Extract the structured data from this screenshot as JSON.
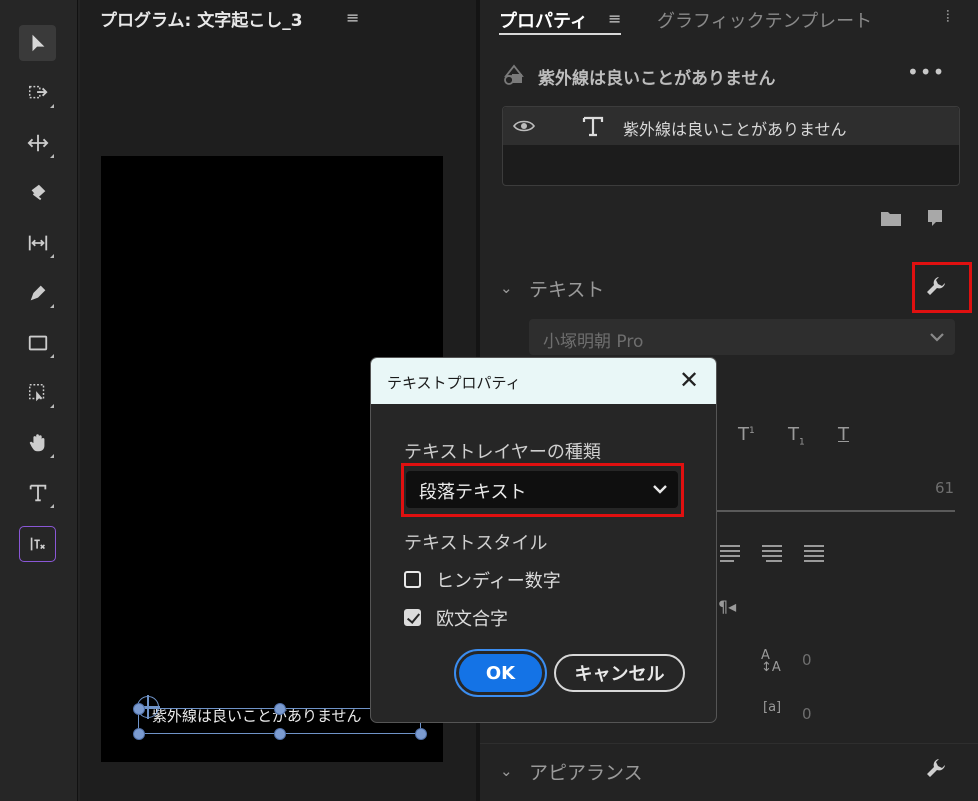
{
  "program": {
    "title": "プログラム: 文字起こし_3",
    "caption": "紫外線は良いことがありません"
  },
  "properties": {
    "tabs": [
      {
        "label": "プロパティ",
        "active": true
      },
      {
        "label": "グラフィックテンプレート",
        "active": false
      }
    ],
    "layer_title": "紫外線は良いことがありません",
    "layer_row_text": "紫外線は良いことがありません",
    "text_section": "テキスト",
    "font_name": "小塚明朝 Pro",
    "font_size_value": "61",
    "tracking_value": "0",
    "kerning_value": "0",
    "appearance_section": "アピアランス"
  },
  "dialog": {
    "title": "テキストプロパティ",
    "layer_type_label": "テキストレイヤーの種類",
    "layer_type_value": "段落テキスト",
    "text_style_label": "テキストスタイル",
    "options": [
      {
        "label": "ヒンディー数字",
        "checked": false
      },
      {
        "label": "欧文合字",
        "checked": true
      }
    ],
    "ok_label": "OK",
    "cancel_label": "キャンセル"
  },
  "colors": {
    "accent_blue": "#1473e6",
    "highlight_red": "#e01010",
    "selection_blue": "#6f93c8"
  }
}
